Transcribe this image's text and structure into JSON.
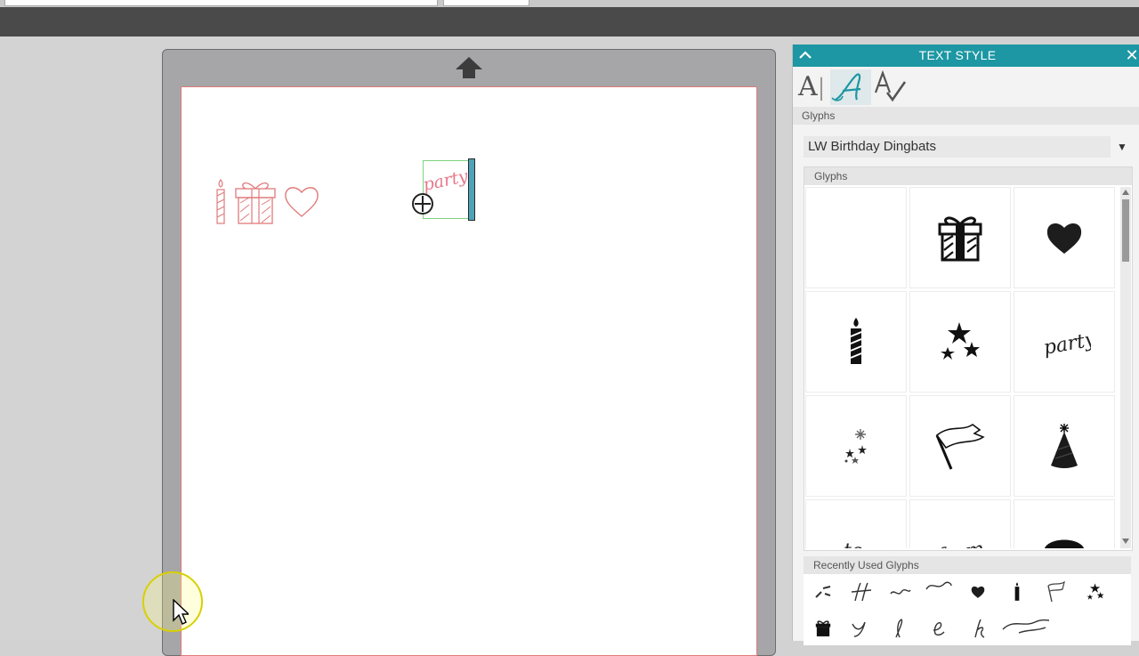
{
  "panel": {
    "title": "TEXT STYLE",
    "close_glyph": "✕",
    "tabs": [
      {
        "name": "basic-text-tab",
        "glyph": "A|"
      },
      {
        "name": "glyphs-tab",
        "glyph": "A"
      },
      {
        "name": "spelling-tab",
        "glyph": "A✓"
      }
    ],
    "glyphs_section_label": "Glyphs",
    "font_value": "LW Birthday Dingbats",
    "glyph_box_label": "Glyphs",
    "glyphs": [
      "blank",
      "gift-icon",
      "heart-icon",
      "candle-icon",
      "stars-icon",
      "party-word",
      "sparkle-icon",
      "flag-icon",
      "party-hat-icon",
      "to-word",
      "from-word",
      "cupcake-icon"
    ],
    "recent_label": "Recently Used Glyphs"
  },
  "canvas": {
    "placed_glyphs": [
      "candle-icon",
      "gift-icon",
      "heart-icon"
    ],
    "selected_text": "party"
  },
  "colors": {
    "accent": "#1c97a3",
    "cut_line": "#e07a7a",
    "selection": "#7ed37e"
  }
}
